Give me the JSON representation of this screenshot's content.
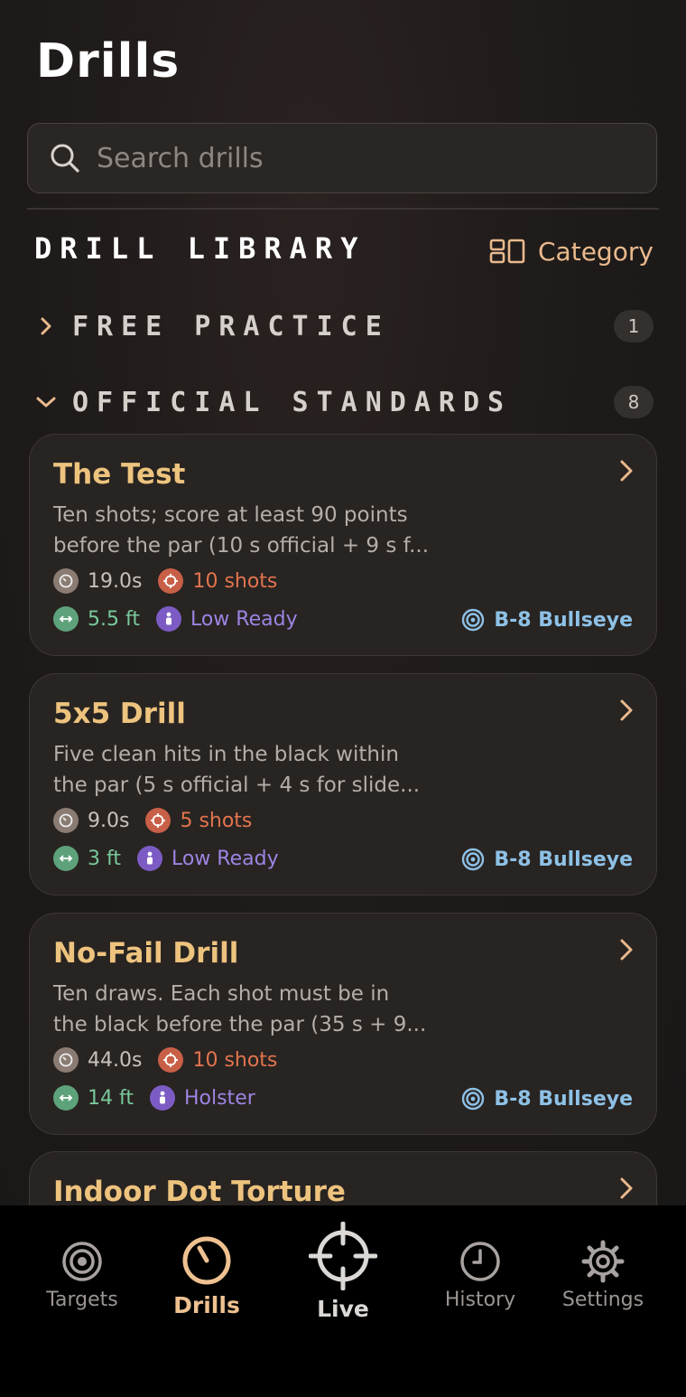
{
  "header": {
    "title": "Drills"
  },
  "search": {
    "placeholder": "Search drills"
  },
  "library": {
    "title": "DRILL LIBRARY",
    "category_label": "Category"
  },
  "sections": [
    {
      "label": "FREE PRACTICE",
      "count": "1",
      "expanded": false
    },
    {
      "label": "OFFICIAL STANDARDS",
      "count": "8",
      "expanded": true
    }
  ],
  "drills": [
    {
      "title": "The Test",
      "desc1": "Ten shots; score at least 90 points",
      "desc2": "before the par (10 s official + 9 s f...",
      "time": "19.0s",
      "shots": "10 shots",
      "distance": "5.5 ft",
      "position": "Low Ready",
      "target": "B-8 Bullseye"
    },
    {
      "title": "5x5 Drill",
      "desc1": "Five clean hits in the black within",
      "desc2": "the par (5 s official + 4 s for slide...",
      "time": "9.0s",
      "shots": "5 shots",
      "distance": "3 ft",
      "position": "Low Ready",
      "target": "B-8 Bullseye"
    },
    {
      "title": "No-Fail Drill",
      "desc1": "Ten draws. Each shot must be in",
      "desc2": "the black before the par (35 s + 9...",
      "time": "44.0s",
      "shots": "10 shots",
      "distance": "14 ft",
      "position": "Holster",
      "target": "B-8 Bullseye"
    },
    {
      "title": "Indoor Dot Torture"
    }
  ],
  "tabbar": {
    "targets": "Targets",
    "drills": "Drills",
    "live": "Live",
    "history": "History",
    "settings": "Settings"
  },
  "colors": {
    "accent": "#efc190",
    "card_title": "#edc37e",
    "shots": "#e2744e",
    "distance": "#78c99b",
    "position": "#9d84e2",
    "target": "#8ec1e6"
  }
}
